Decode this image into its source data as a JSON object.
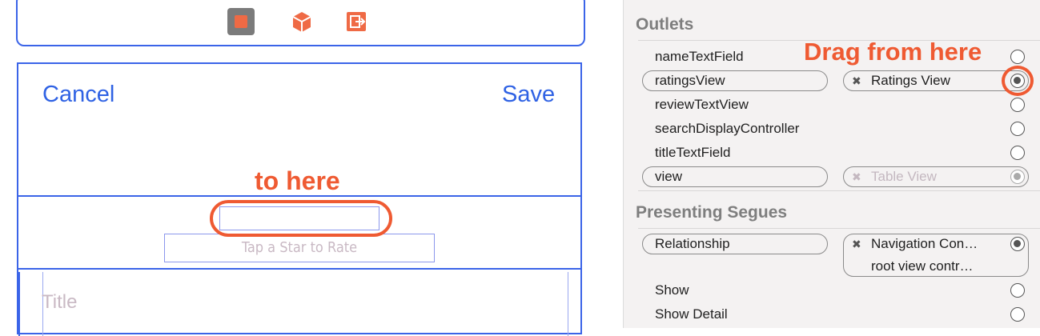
{
  "storyboard": {
    "nav": {
      "cancel_label": "Cancel",
      "save_label": "Save"
    },
    "rating_label": "Tap a Star to Rate",
    "title_placeholder": "Title",
    "icons": [
      "view-controller-icon",
      "first-responder-icon",
      "exit-icon"
    ]
  },
  "annotations": {
    "target_text": "to here",
    "source_text": "Drag from here",
    "color": "#ef5a32"
  },
  "inspector": {
    "outlets_title": "Outlets",
    "outlets": [
      {
        "name": "nameTextField",
        "connected": false
      },
      {
        "name": "ratingsView",
        "connected": true,
        "target": "Ratings View"
      },
      {
        "name": "reviewTextView",
        "connected": false
      },
      {
        "name": "searchDisplayController",
        "connected": false
      },
      {
        "name": "titleTextField",
        "connected": false
      },
      {
        "name": "view",
        "connected": true,
        "target": "Table View"
      }
    ],
    "segues_title": "Presenting Segues",
    "segues": [
      {
        "name": "Relationship",
        "connected": true,
        "target_line1": "Navigation Con…",
        "target_line2": "root view contr…"
      },
      {
        "name": "Show",
        "connected": false
      },
      {
        "name": "Show Detail",
        "connected": false
      }
    ]
  },
  "colors": {
    "accent_blue": "#3b64e8",
    "annotation_orange": "#ef5a32"
  }
}
